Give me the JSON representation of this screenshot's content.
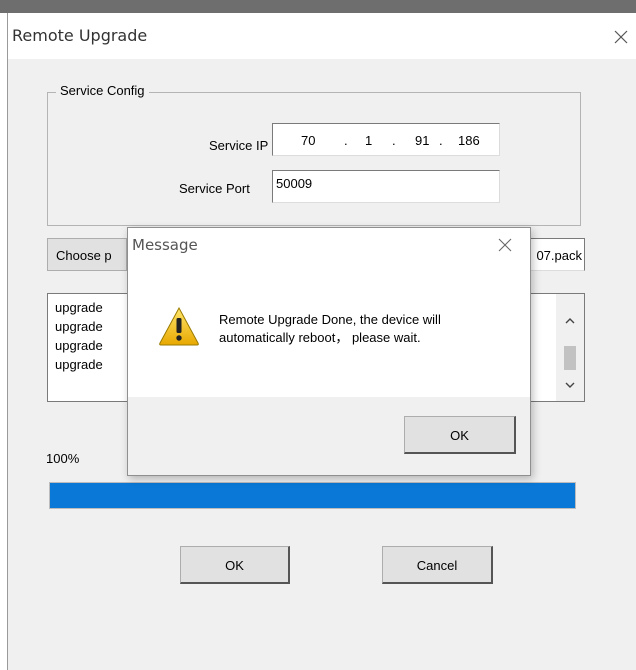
{
  "window": {
    "title": "Remote Upgrade"
  },
  "service_config": {
    "group_label": "Service Config",
    "ip_label": "Service IP",
    "ip": [
      "70",
      "1",
      "91",
      "186"
    ],
    "port_label": "Service Port",
    "port": "50009"
  },
  "file": {
    "choose_label": "Choose p",
    "path_value": "07.pack"
  },
  "log": {
    "lines": [
      "upgrade",
      "upgrade",
      "upgrade",
      "upgrade"
    ]
  },
  "progress": {
    "percent_text": "100%",
    "value": 1.0,
    "color": "#0a78d7"
  },
  "buttons": {
    "ok": "OK",
    "cancel": "Cancel"
  },
  "message_dialog": {
    "title": "Message",
    "text_line1": "Remote Upgrade  Done, the device will",
    "text_line2": "automatically reboot， please wait.",
    "ok": "OK",
    "icon": "warning-icon"
  }
}
